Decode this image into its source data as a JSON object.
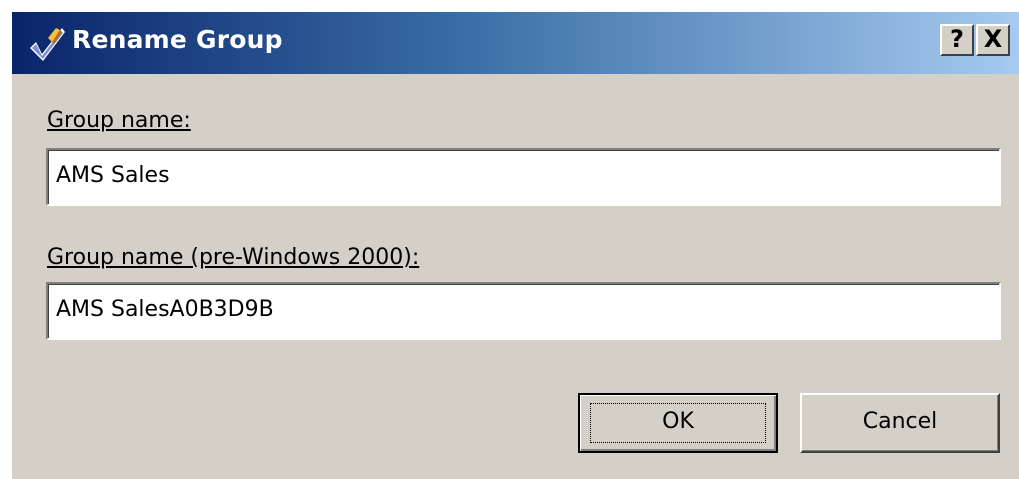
{
  "window": {
    "title": "Rename Group",
    "help_button": "?",
    "close_button": "X"
  },
  "form": {
    "group_name_label": "Group name:",
    "group_name_value": "AMS Sales",
    "group_name_pre2000_label": "Group name (pre-Windows 2000):",
    "group_name_pre2000_value": "AMS SalesA0B3D9B"
  },
  "buttons": {
    "ok_label": "OK",
    "cancel_label": "Cancel"
  },
  "icons": {
    "title_icon": "rename-pencil-icon"
  },
  "colors": {
    "titlebar_start": "#0a246a",
    "titlebar_end": "#a6caf0",
    "dialog_face": "#d4d0c8"
  }
}
